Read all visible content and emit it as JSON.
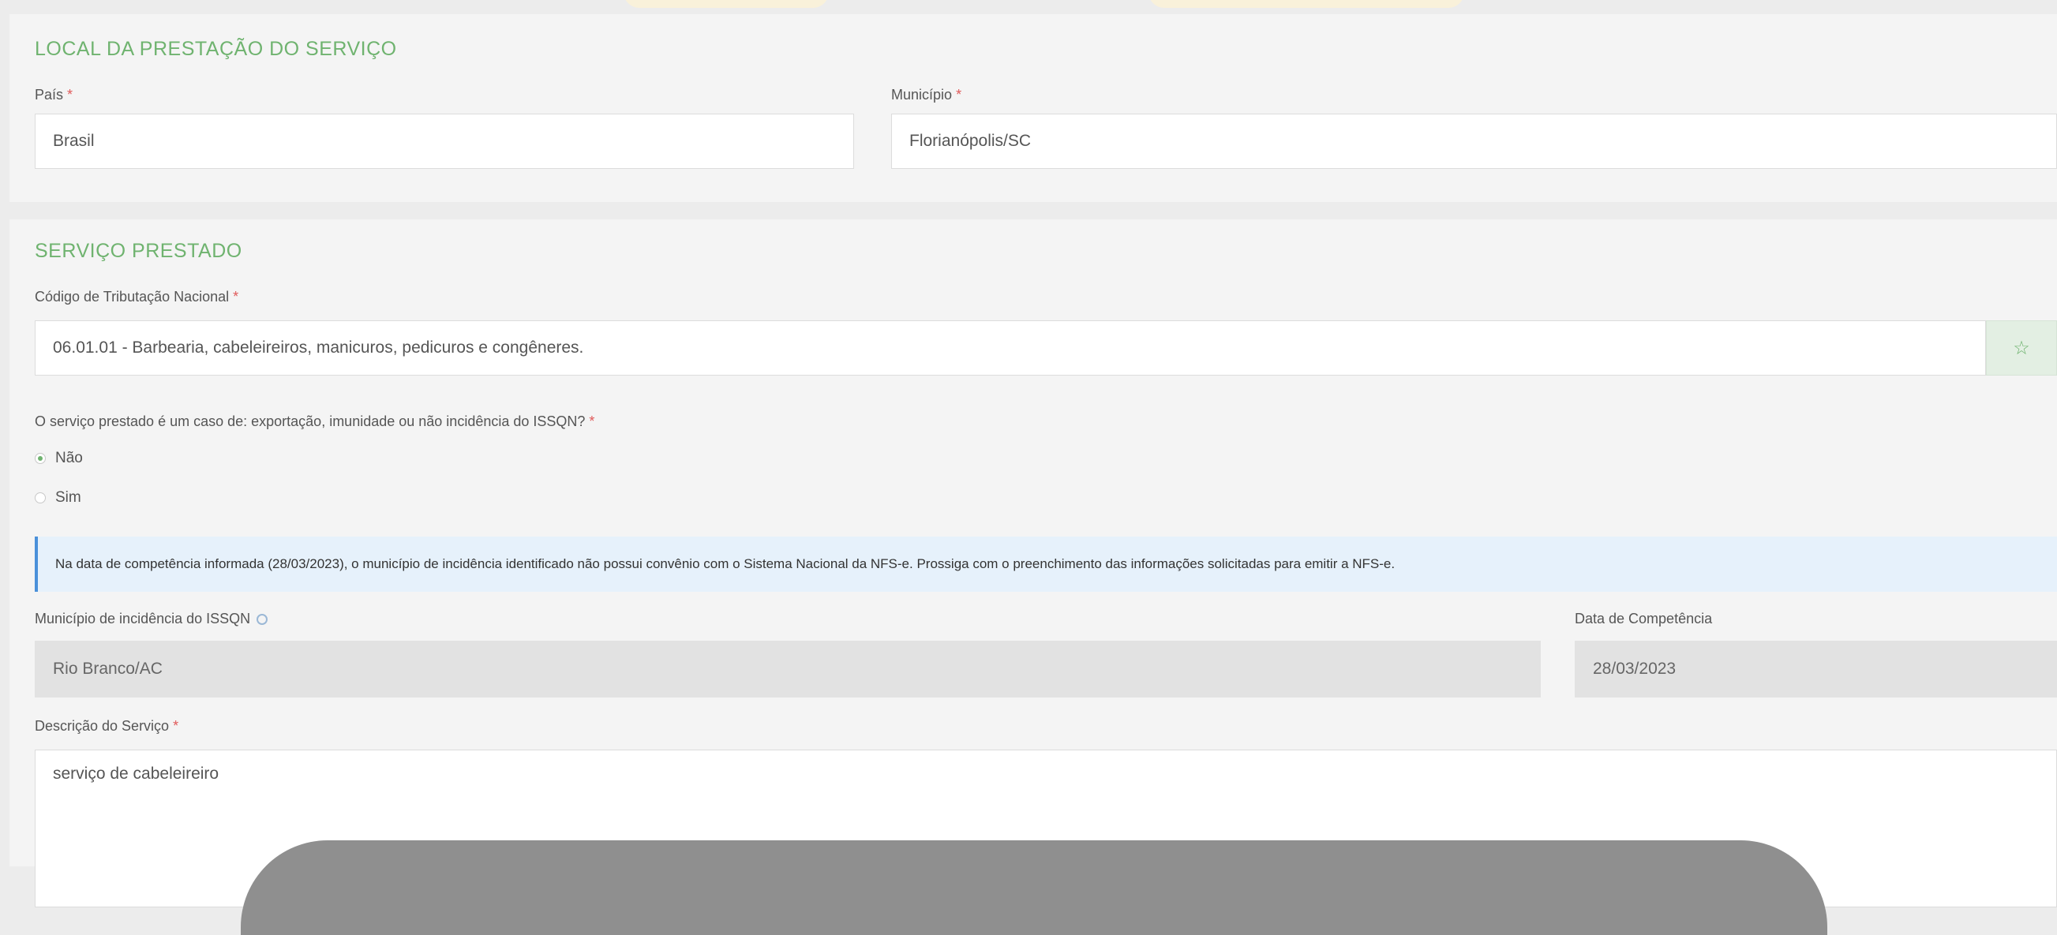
{
  "colors": {
    "accent_green": "#6fb36f",
    "required_red": "#e05a5a",
    "info_blue": "#4a90d9",
    "info_bg": "#e6f1fb"
  },
  "local": {
    "title": "LOCAL DA PRESTAÇÃO DO SERVIÇO",
    "pais_label": "País",
    "pais_value": "Brasil",
    "municipio_label": "Município",
    "municipio_value": "Florianópolis/SC"
  },
  "servico": {
    "title": "SERVIÇO PRESTADO",
    "codigo_label": "Código de Tributação Nacional",
    "codigo_value": "06.01.01 - Barbearia, cabeleireiros, manicuros, pedicuros e congêneres.",
    "favorite_icon": "star-icon",
    "question": "O serviço prestado é um caso de: exportação, imunidade ou não incidência do ISSQN?",
    "options": [
      {
        "label": "Não",
        "checked": true
      },
      {
        "label": "Sim",
        "checked": false
      }
    ],
    "info": "Na data de competência informada (28/03/2023), o município de incidência identificado não possui convênio com o Sistema Nacional da NFS-e. Prossiga com o preenchimento das informações solicitadas para emitir a NFS-e.",
    "incidencia_label": "Município de incidência do ISSQN",
    "incidencia_value": "Rio Branco/AC",
    "competencia_label": "Data de Competência",
    "competencia_value": "28/03/2023",
    "descricao_label": "Descrição do Serviço",
    "descricao_value": "serviço de cabeleireiro"
  },
  "required_mark": "*"
}
